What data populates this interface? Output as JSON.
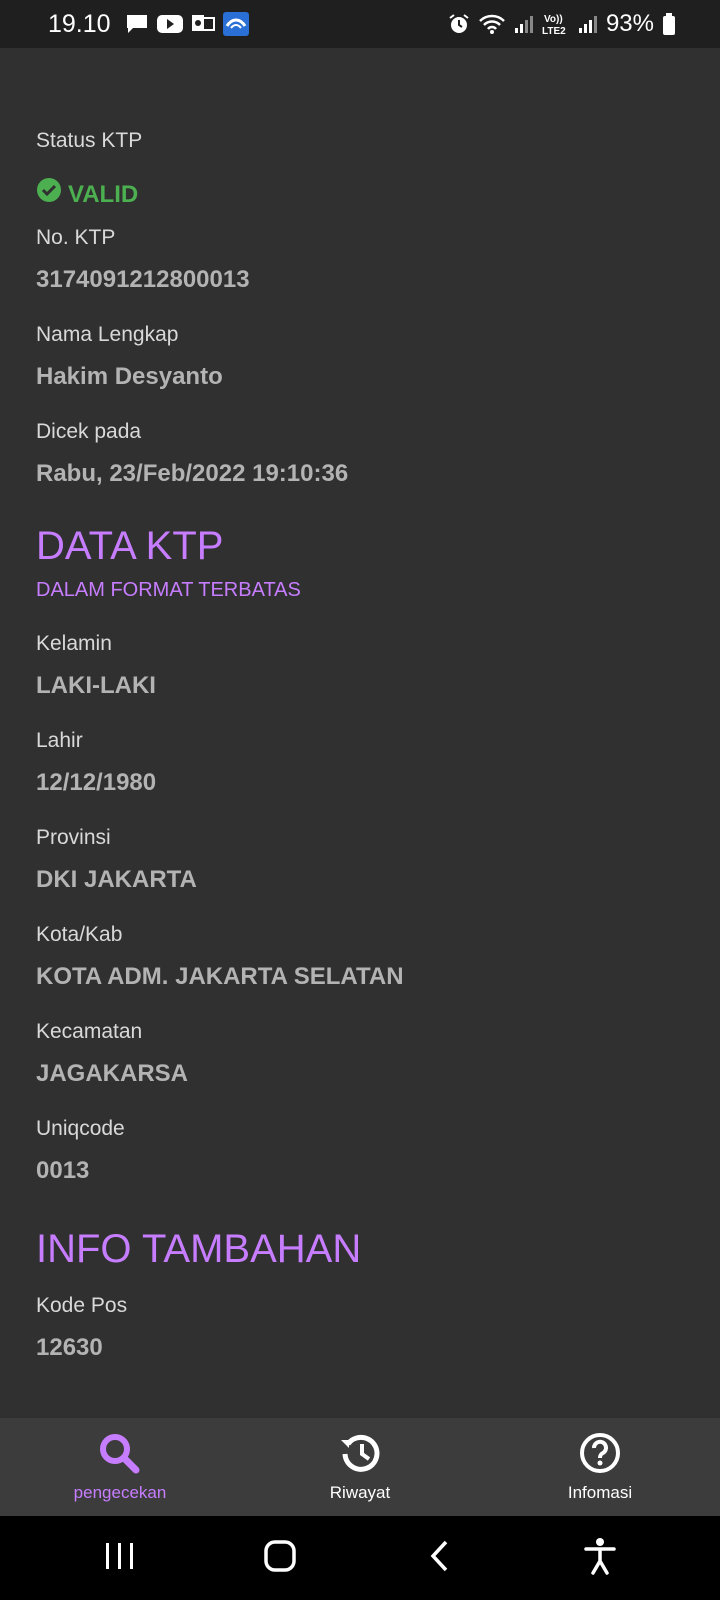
{
  "status_bar": {
    "time": "19.10",
    "battery_percent": "93%",
    "left_icons": [
      "chat-icon",
      "youtube-icon",
      "outlook-icon",
      "app-icon"
    ],
    "right_icons": [
      "alarm-icon",
      "wifi-icon",
      "signal-icon",
      "volte-icon",
      "signal-icon",
      "battery-icon"
    ]
  },
  "summary": {
    "status_label": "Status KTP",
    "status_value": "VALID",
    "no_label": "No. KTP",
    "no_value": "3174091212800013",
    "name_label": "Nama Lengkap",
    "name_value": "Hakim Desyanto",
    "checked_label": "Dicek pada",
    "checked_value": "Rabu, 23/Feb/2022 19:10:36"
  },
  "data_ktp": {
    "title": "DATA KTP",
    "subtitle": "DALAM FORMAT TERBATAS",
    "fields": [
      {
        "label": "Kelamin",
        "value": "LAKI-LAKI"
      },
      {
        "label": "Lahir",
        "value": "12/12/1980"
      },
      {
        "label": "Provinsi",
        "value": "DKI JAKARTA"
      },
      {
        "label": "Kota/Kab",
        "value": "KOTA ADM. JAKARTA SELATAN"
      },
      {
        "label": "Kecamatan",
        "value": "JAGAKARSA"
      },
      {
        "label": "Uniqcode",
        "value": "0013"
      }
    ]
  },
  "info_tambahan": {
    "title": "INFO TAMBAHAN",
    "fields": [
      {
        "label": "Kode Pos",
        "value": "12630"
      }
    ]
  },
  "bottom_nav": {
    "items": [
      {
        "label": "pengecekan",
        "icon": "search-icon"
      },
      {
        "label": "Riwayat",
        "icon": "history-icon"
      },
      {
        "label": "Infomasi",
        "icon": "help-icon"
      }
    ],
    "active_color": "#c77dff"
  },
  "colors": {
    "accent": "#c77dff",
    "valid": "#4caf50",
    "background": "#303030"
  }
}
